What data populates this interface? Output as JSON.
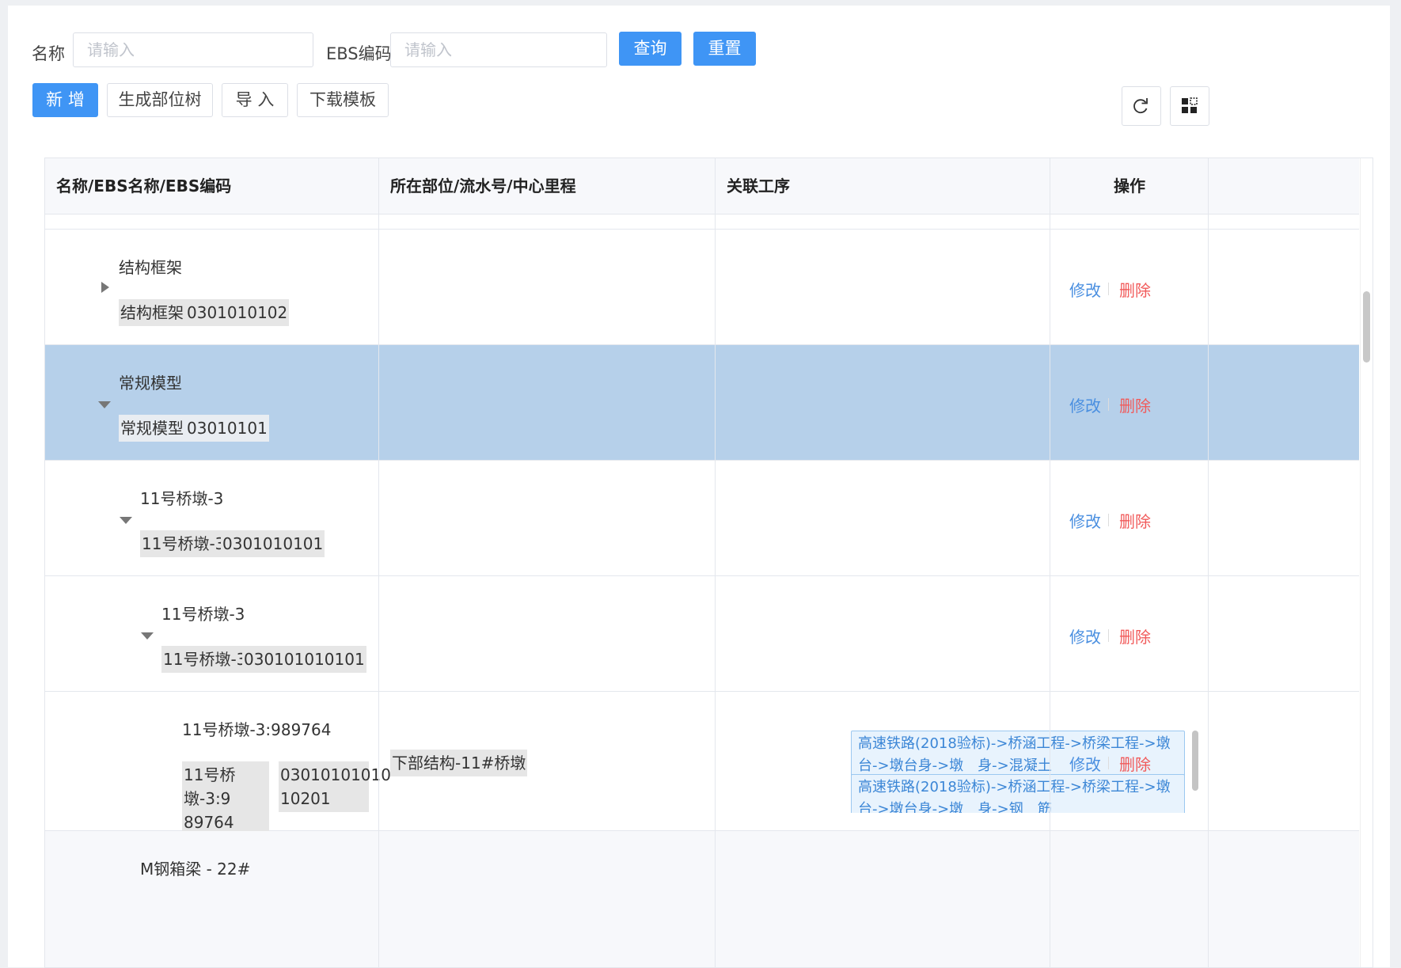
{
  "search": {
    "name_label": "名称",
    "name_placeholder": "请输入",
    "ebs_label": "EBS编码",
    "ebs_placeholder": "请输入",
    "query_button": "查询",
    "reset_button": "重置"
  },
  "toolbar": {
    "add_button": "新 增",
    "generate_tree_button": "生成部位树",
    "import_button": "导 入",
    "download_template_button": "下载模板"
  },
  "table": {
    "columns": [
      "名称/EBS名称/EBS编码",
      "所在部位/流水号/中心里程",
      "关联工序",
      "操作"
    ],
    "rows": [
      {
        "name": "结构框架",
        "ebs_name": "结构框架",
        "ebs_code": "0301010102",
        "expanded": false,
        "location": "",
        "processes": []
      },
      {
        "name": "常规模型",
        "ebs_name": "常规模型",
        "ebs_code": "03010101",
        "expanded": true,
        "selected": true,
        "location": "",
        "processes": []
      },
      {
        "name": "11号桥墩-3",
        "ebs_name": "11号桥墩-3",
        "ebs_code": "0301010101",
        "expanded": true,
        "location": "",
        "processes": []
      },
      {
        "name": "11号桥墩-3",
        "ebs_name": "11号桥墩-3",
        "ebs_code": "030101010101",
        "expanded": true,
        "location": "",
        "processes": []
      },
      {
        "name": "11号桥墩-3:989764",
        "ebs_name_l1": "11号桥墩-3:9",
        "ebs_name_l2": "89764",
        "ebs_code_l1": "03010101010",
        "ebs_code_l2": "10201",
        "location": "下部结构-11#桥墩",
        "processes": [
          {
            "l1": "高速铁路(2018验标)->桥涵工程->桥梁工程->墩",
            "l2": "台->墩台身->墩　身->混凝土"
          },
          {
            "l1": "高速铁路(2018验标)->桥涵工程->桥梁工程->墩",
            "l2": "台->墩台身->墩　身->钢　筋"
          }
        ]
      },
      {
        "name": "M钢箱梁 - 22#"
      }
    ],
    "actions": {
      "edit": "修改",
      "delete": "删除"
    }
  },
  "icons": {
    "refresh": "refresh-icon",
    "columns": "grid-icon"
  },
  "colors": {
    "primary": "#3f95f5",
    "selected_row": "#b6d0ea",
    "edit_link": "#4a8fe0",
    "delete_link": "#f15a5a"
  }
}
